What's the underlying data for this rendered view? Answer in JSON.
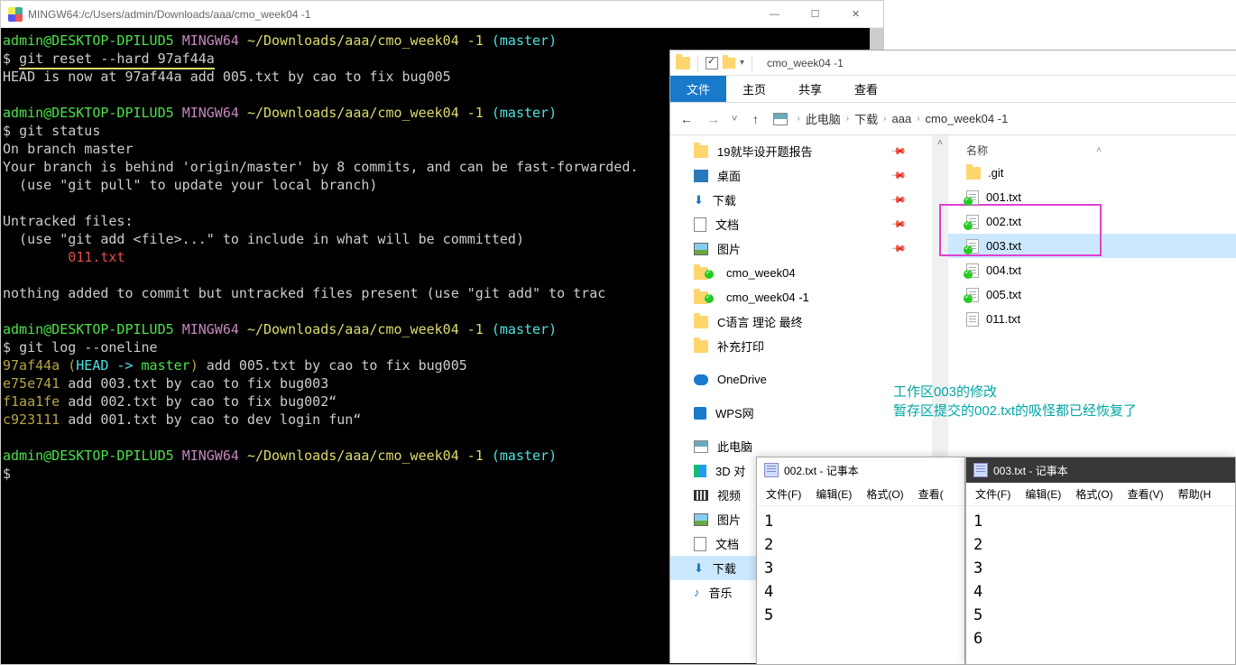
{
  "terminal": {
    "title": "MINGW64:/c/Users/admin/Downloads/aaa/cmo_week04 -1",
    "prompt_user": "admin@DESKTOP-DPILUD5",
    "prompt_env": "MINGW64",
    "prompt_path": "~/Downloads/aaa/cmo_week04 -1",
    "prompt_branch": "(master)",
    "cmd1": "git reset --hard 97af44a",
    "out1": "HEAD is now at 97af44a add 005.txt by cao to fix bug005",
    "cmd2": "git status",
    "status_l1": "On branch master",
    "status_l2": "Your branch is behind 'origin/master' by 8 commits, and can be fast-forwarded.",
    "status_l3": "  (use \"git pull\" to update your local branch)",
    "status_l4": "Untracked files:",
    "status_l5": "  (use \"git add <file>...\" to include in what will be committed)",
    "status_file": "        011.txt",
    "status_l6": "nothing added to commit but untracked files present (use \"git add\" to trac",
    "cmd3": "git log --oneline",
    "log1_hash": "97af44a",
    "log1_ref_open": "(",
    "log1_head": "HEAD -> ",
    "log1_branch": "master",
    "log1_ref_close": ")",
    "log1_msg": " add 005.txt by cao to fix bug005",
    "log2_hash": "e75e741",
    "log2_msg": " add 003.txt by cao to fix bug003",
    "log3_hash": "f1aa1fe",
    "log3_msg": " add 002.txt by cao to fix bug002“",
    "log4_hash": "c923111",
    "log4_msg": " add 001.txt by cao to dev login fun“",
    "prompt_cursor": "$"
  },
  "explorer": {
    "folder_title": "cmo_week04 -1",
    "ribbon": {
      "file": "文件",
      "home": "主页",
      "share": "共享",
      "view": "查看"
    },
    "breadcrumb": [
      "此电脑",
      "下载",
      "aaa",
      "cmo_week04 -1"
    ],
    "sidebar": [
      {
        "label": "19就毕设开题报告",
        "pin": true,
        "icon": "folder"
      },
      {
        "label": "桌面",
        "pin": true,
        "icon": "desktop"
      },
      {
        "label": "下载",
        "pin": true,
        "icon": "download"
      },
      {
        "label": "文档",
        "pin": true,
        "icon": "doc"
      },
      {
        "label": "图片",
        "pin": true,
        "icon": "img"
      },
      {
        "label": "cmo_week04",
        "pin": false,
        "icon": "folder"
      },
      {
        "label": "cmo_week04 -1",
        "pin": false,
        "icon": "folder"
      },
      {
        "label": "C语言 理论 最终",
        "pin": false,
        "icon": "folder"
      },
      {
        "label": "补充打印",
        "pin": false,
        "icon": "folder"
      },
      {
        "label": "OneDrive",
        "pin": false,
        "icon": "cloud",
        "gap": true
      },
      {
        "label": "WPS网",
        "pin": false,
        "icon": "wps",
        "gap": true
      },
      {
        "label": "此电脑",
        "pin": false,
        "icon": "pc",
        "gap": true
      },
      {
        "label": "3D 对",
        "pin": false,
        "icon": "cube"
      },
      {
        "label": "视频",
        "pin": false,
        "icon": "video"
      },
      {
        "label": "图片",
        "pin": false,
        "icon": "img"
      },
      {
        "label": "文档",
        "pin": false,
        "icon": "doc"
      },
      {
        "label": "下载",
        "pin": false,
        "icon": "download",
        "selected": true
      },
      {
        "label": "音乐",
        "pin": false,
        "icon": "music"
      }
    ],
    "col_name": "名称",
    "files": [
      {
        "name": ".git",
        "type": "folder"
      },
      {
        "name": "001.txt",
        "type": "txt",
        "check": true
      },
      {
        "name": "002.txt",
        "type": "txt",
        "check": true
      },
      {
        "name": "003.txt",
        "type": "txt",
        "check": true,
        "selected": true
      },
      {
        "name": "004.txt",
        "type": "txt",
        "check": true
      },
      {
        "name": "005.txt",
        "type": "txt",
        "check": true
      },
      {
        "name": "011.txt",
        "type": "txt"
      }
    ],
    "folder_check1": {
      "has": true
    },
    "folder_check2": {
      "has": true
    }
  },
  "annotation": {
    "line1": "工作区003的修改",
    "line2": "暂存区提交的002.txt的吸怪都已经恢复了"
  },
  "notepad1": {
    "title": "002.txt - 记事本",
    "menu": [
      "文件(F)",
      "编辑(E)",
      "格式(O)",
      "查看("
    ],
    "content": "1\n2\n3\n4\n5"
  },
  "notepad2": {
    "title": "003.txt - 记事本",
    "menu": [
      "文件(F)",
      "编辑(E)",
      "格式(O)",
      "查看(V)",
      "帮助(H"
    ],
    "content": "1\n2\n3\n4\n5\n6"
  }
}
